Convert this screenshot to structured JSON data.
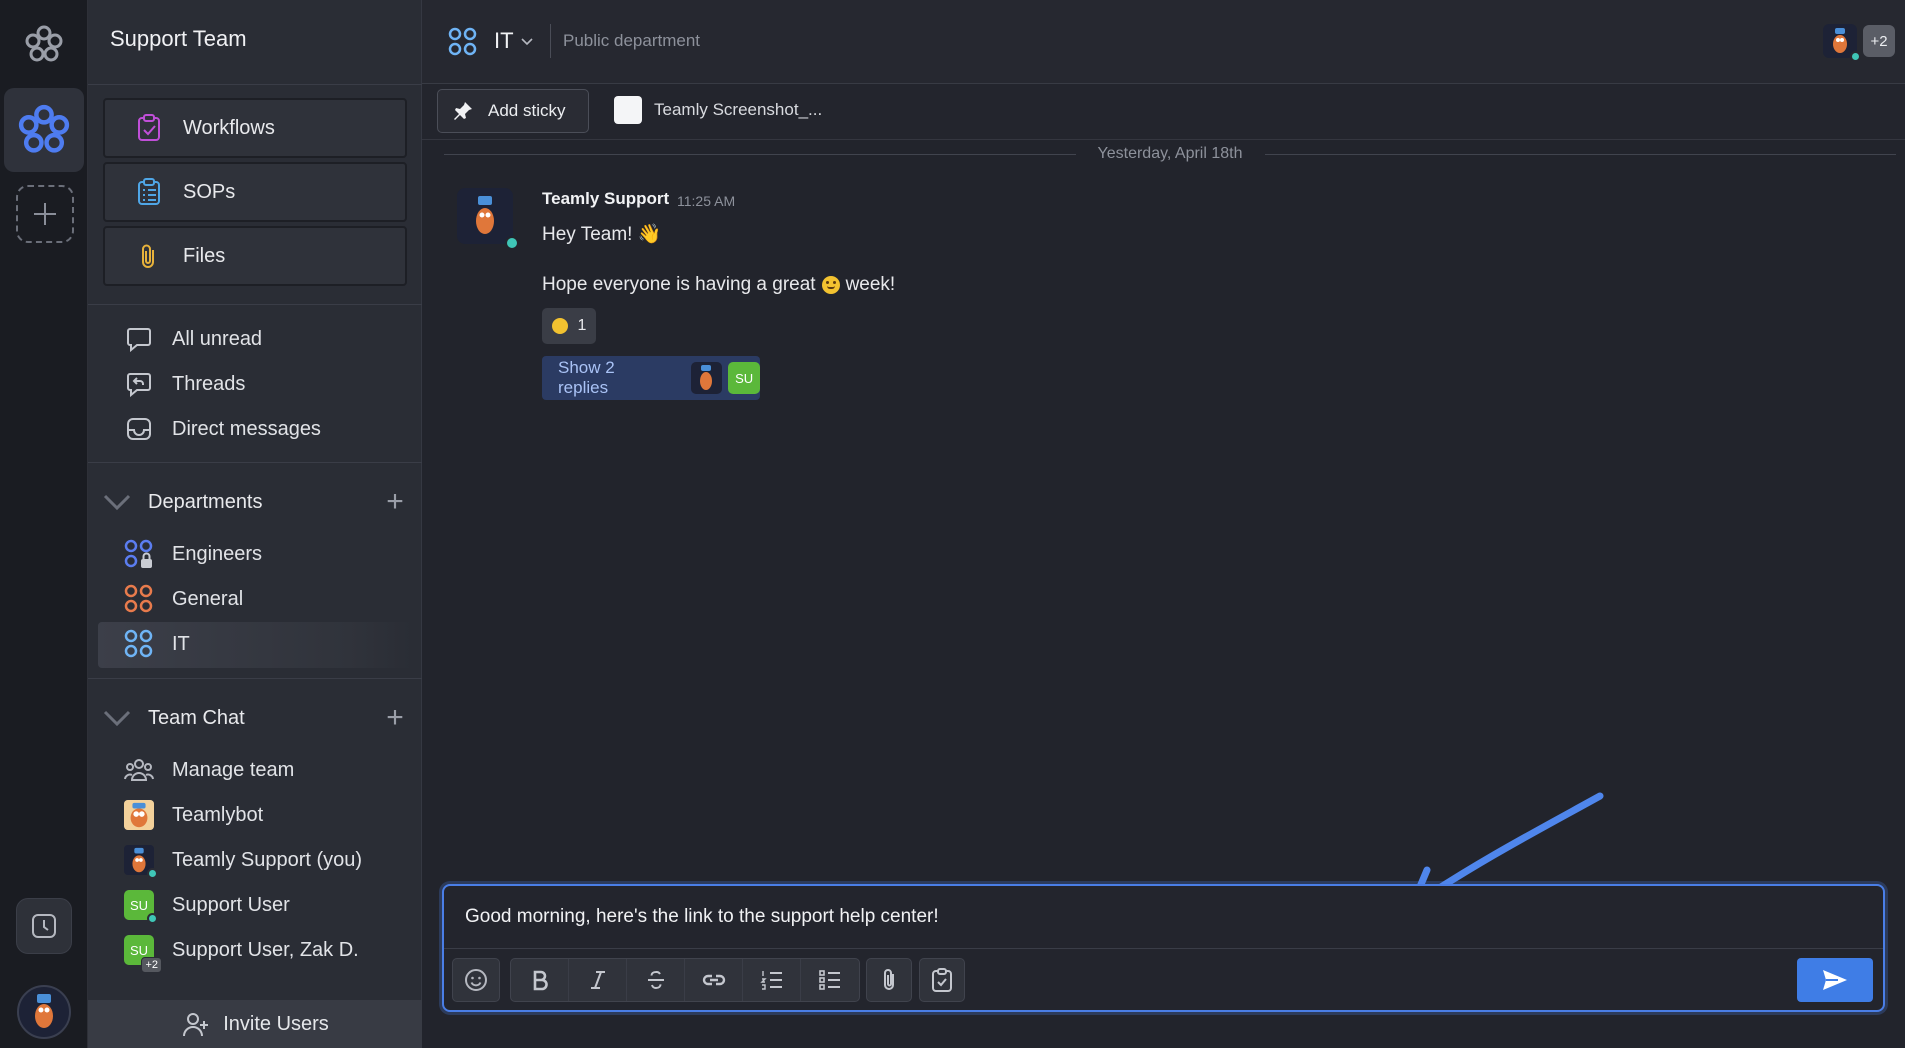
{
  "workspace": {
    "name": "Support Team"
  },
  "sidebar": {
    "cards": [
      {
        "label": "Workflows",
        "icon": "clipboard-check-icon"
      },
      {
        "label": "SOPs",
        "icon": "clipboard-list-icon"
      },
      {
        "label": "Files",
        "icon": "paperclip-icon"
      }
    ],
    "nav": [
      {
        "label": "All unread",
        "icon": "chat-bubble-icon"
      },
      {
        "label": "Threads",
        "icon": "threads-icon"
      },
      {
        "label": "Direct messages",
        "icon": "inbox-icon"
      }
    ],
    "departments": {
      "header": "Departments",
      "items": [
        {
          "label": "Engineers",
          "color": "#5b7df0"
        },
        {
          "label": "General",
          "color": "#e87b4c"
        },
        {
          "label": "IT",
          "color": "#6fb4f5"
        }
      ]
    },
    "team_chat": {
      "header": "Team Chat",
      "items": [
        {
          "label": "Manage team"
        },
        {
          "label": "Teamlybot"
        },
        {
          "label": "Teamly Support (you)"
        },
        {
          "label": "Support User",
          "initials": "SU"
        },
        {
          "label": "Support User, Zak D.",
          "initials": "SU",
          "extra": "+2"
        }
      ]
    },
    "invite_label": "Invite Users"
  },
  "channel": {
    "name": "IT",
    "type": "Public department",
    "extra_members": "+2"
  },
  "toolbar": {
    "add_sticky": "Add sticky",
    "file_name": "Teamly Screenshot_..."
  },
  "messages": {
    "date_divider": "Yesterday, April 18th",
    "author": "Teamly Support",
    "time": "11:25 AM",
    "line1": "Hey Team! 👋",
    "line2_a": "Hope everyone is having a great",
    "line2_b": "week!",
    "reaction_count": "1",
    "replies_label": "Show 2 replies",
    "reply_initials": "SU"
  },
  "composer": {
    "text": "Good morning, here's the link to the support help center!"
  },
  "colors": {
    "accent": "#3f7de6",
    "online": "#3fc6b7",
    "su_green": "#5bb83a"
  }
}
